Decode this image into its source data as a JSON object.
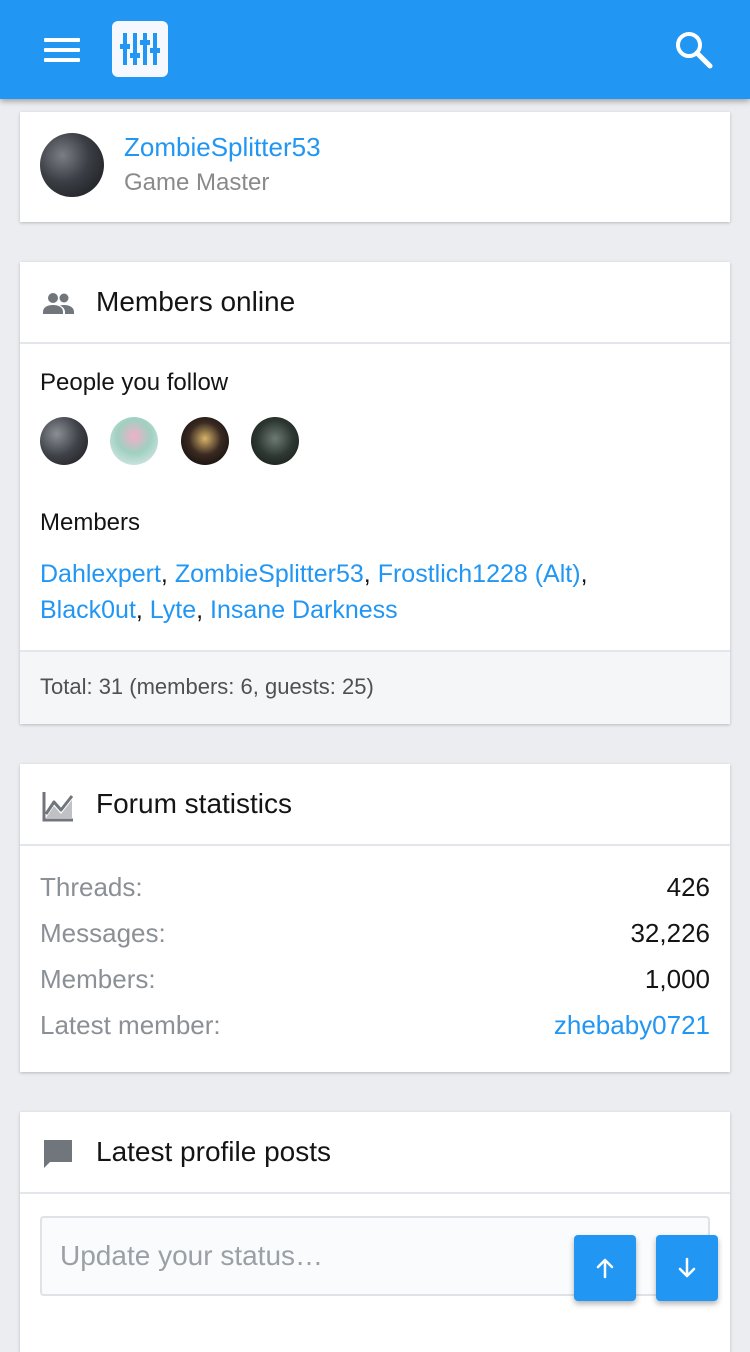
{
  "header": {
    "menu_icon": "hamburger-menu-icon",
    "logo_icon": "sliders-logo-icon",
    "search_icon": "search-icon",
    "brand_color": "#2196f3"
  },
  "staff_member": {
    "username": "ZombieSplitter53",
    "title": "Game Master"
  },
  "members_online": {
    "title": "Members online",
    "icon": "people-icon",
    "follow_label": "People you follow",
    "members_label": "Members",
    "members": [
      "Dahlexpert",
      "ZombieSplitter53",
      "Frostlich1228 (Alt)",
      "Black0ut",
      "Lyte",
      "Insane Darkness"
    ],
    "separator": ", ",
    "total": "Total: 31 (members: 6, guests: 25)"
  },
  "forum_statistics": {
    "title": "Forum statistics",
    "icon": "chart-line-icon",
    "rows": [
      {
        "label": "Threads:",
        "value": "426"
      },
      {
        "label": "Messages:",
        "value": "32,226"
      },
      {
        "label": "Members:",
        "value": "1,000"
      },
      {
        "label": "Latest member:",
        "value": "zhebaby0721"
      }
    ]
  },
  "profile_posts": {
    "title": "Latest profile posts",
    "icon": "comment-icon",
    "placeholder": "Update your status…"
  },
  "scroll_buttons": {
    "up_icon": "arrow-up-icon",
    "down_icon": "arrow-down-icon"
  }
}
